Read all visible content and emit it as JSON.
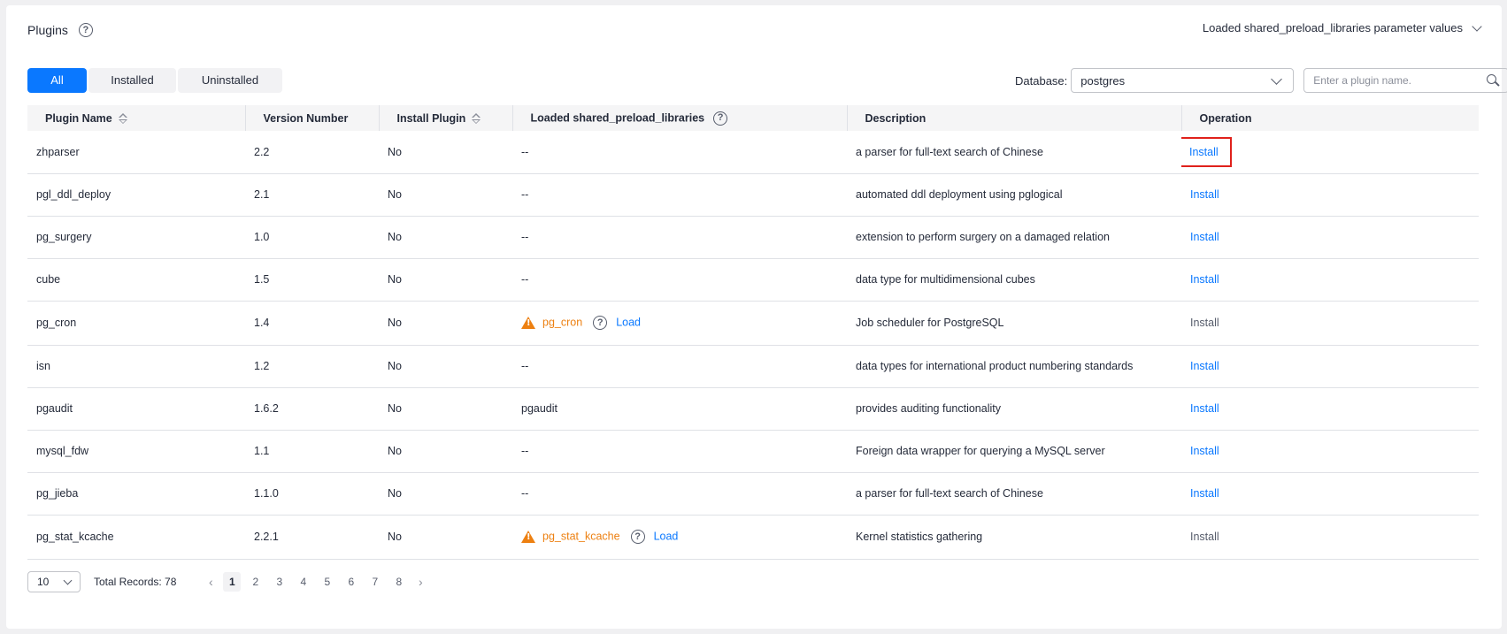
{
  "header": {
    "title": "Plugins",
    "help_glyph": "?",
    "loaded_dropdown_label": "Loaded shared_preload_libraries parameter values"
  },
  "tabs": [
    {
      "label": "All",
      "active": true
    },
    {
      "label": "Installed",
      "active": false
    },
    {
      "label": "Uninstalled",
      "active": false
    }
  ],
  "filter": {
    "database_label": "Database:",
    "database_value": "postgres",
    "search_placeholder": "Enter a plugin name."
  },
  "table": {
    "columns": [
      "Plugin Name",
      "Version Number",
      "Install Plugin",
      "Loaded shared_preload_libraries",
      "Description",
      "Operation"
    ],
    "rows": [
      {
        "name": "zhparser",
        "version": "2.2",
        "installed": "No",
        "loaded": "--",
        "description": "a parser for full-text search of Chinese",
        "operation": "Install"
      },
      {
        "name": "pgl_ddl_deploy",
        "version": "2.1",
        "installed": "No",
        "loaded": "--",
        "description": "automated ddl deployment using pglogical",
        "operation": "Install"
      },
      {
        "name": "pg_surgery",
        "version": "1.0",
        "installed": "No",
        "loaded": "--",
        "description": "extension to perform surgery on a damaged relation",
        "operation": "Install"
      },
      {
        "name": "cube",
        "version": "1.5",
        "installed": "No",
        "loaded": "--",
        "description": "data type for multidimensional cubes",
        "operation": "Install"
      },
      {
        "name": "pg_cron",
        "version": "1.4",
        "installed": "No",
        "loaded": "pg_cron",
        "load_label": "Load",
        "description": "Job scheduler for PostgreSQL",
        "operation": "Install"
      },
      {
        "name": "isn",
        "version": "1.2",
        "installed": "No",
        "loaded": "--",
        "description": "data types for international product numbering standards",
        "operation": "Install"
      },
      {
        "name": "pgaudit",
        "version": "1.6.2",
        "installed": "No",
        "loaded": "pgaudit",
        "description": "provides auditing functionality",
        "operation": "Install"
      },
      {
        "name": "mysql_fdw",
        "version": "1.1",
        "installed": "No",
        "loaded": "--",
        "description": "Foreign data wrapper for querying a MySQL server",
        "operation": "Install"
      },
      {
        "name": "pg_jieba",
        "version": "1.1.0",
        "installed": "No",
        "loaded": "--",
        "description": "a parser for full-text search of Chinese",
        "operation": "Install"
      },
      {
        "name": "pg_stat_kcache",
        "version": "2.2.1",
        "installed": "No",
        "loaded": "pg_stat_kcache",
        "load_label": "Load",
        "description": "Kernel statistics gathering",
        "operation": "Install"
      }
    ]
  },
  "pagination": {
    "page_size": "10",
    "total_label": "Total Records: 78",
    "prev_glyph": "‹",
    "next_glyph": "›",
    "pages": [
      "1",
      "2",
      "3",
      "4",
      "5",
      "6",
      "7",
      "8"
    ],
    "current_page": "1"
  },
  "colors": {
    "accent": "#0a78ff",
    "warning": "#ed8011",
    "highlight_box": "#e0211b"
  }
}
